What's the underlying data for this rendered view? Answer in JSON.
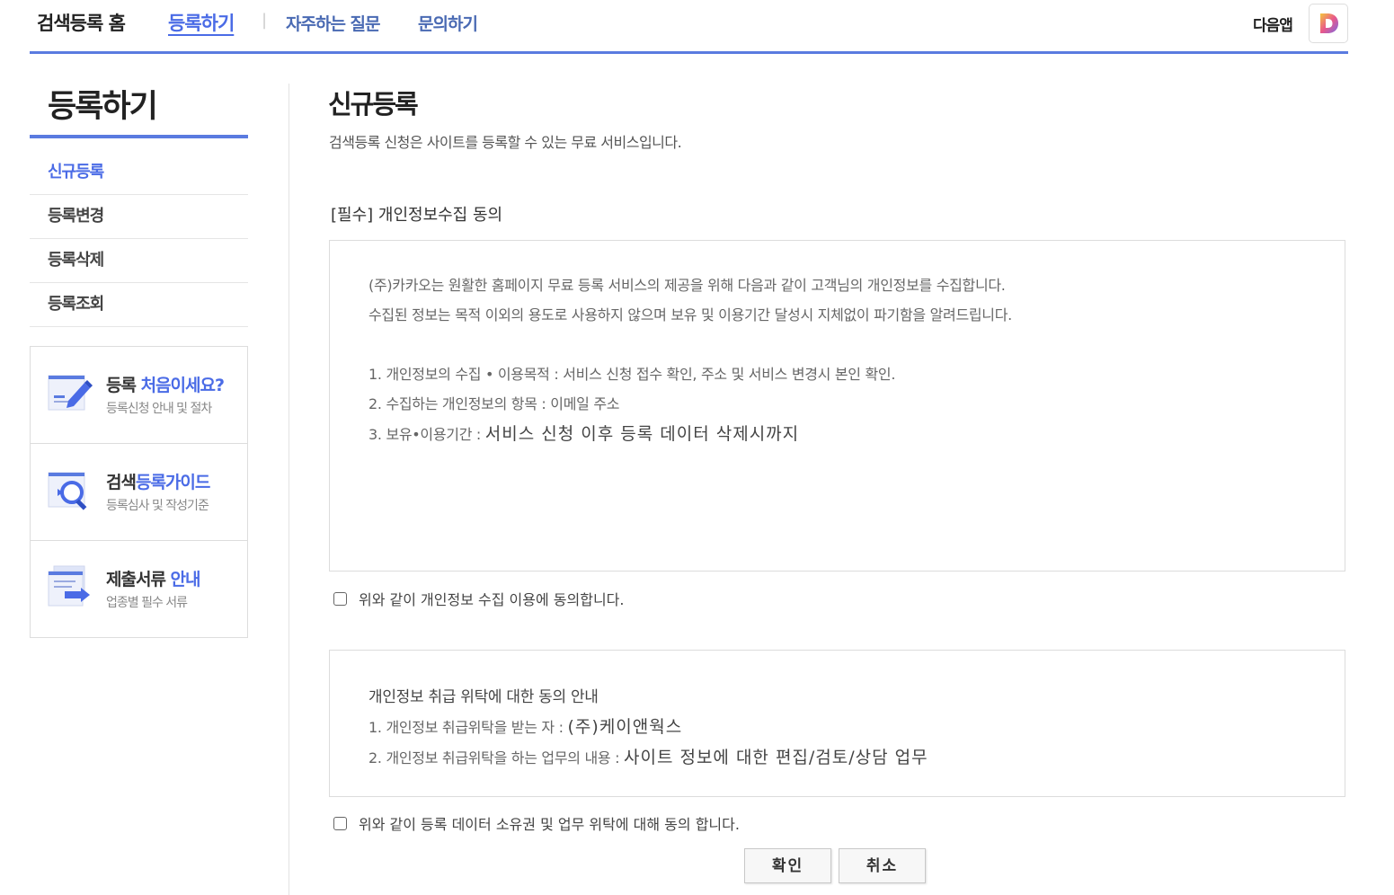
{
  "topnav": {
    "home": "검색등록 홈",
    "register": "등록하기",
    "separator": "|",
    "faq": "자주하는 질문",
    "contact": "문의하기",
    "app_label": "다음앱"
  },
  "sidebar": {
    "title": "등록하기",
    "items": [
      {
        "label": "신규등록",
        "active": true
      },
      {
        "label": "등록변경"
      },
      {
        "label": "등록삭제"
      },
      {
        "label": "등록조회"
      }
    ],
    "cards": [
      {
        "title_plain": "등록 ",
        "title_highlight": "처음이세요?",
        "subtitle": "등록신청 안내 및 절차",
        "icon": "pencil-document-icon"
      },
      {
        "title_plain": "검색",
        "title_highlight": "등록가이드",
        "subtitle": "등록심사 및 작성기준",
        "icon": "magnifier-document-icon"
      },
      {
        "title_plain": "제출서류 ",
        "title_highlight": "안내",
        "subtitle": "업종별 필수 서류",
        "icon": "documents-arrow-icon"
      }
    ]
  },
  "main": {
    "title": "신규등록",
    "description": "검색등록 신청은 사이트를 등록할 수 있는 무료 서비스입니다.",
    "privacy_section_title": "[필수] 개인정보수집 동의",
    "privacy_box": {
      "intro1": "(주)카카오는 원활한 홈페이지 무료 등록 서비스의 제공을 위해 다음과 같이 고객님의 개인정보를 수집합니다.",
      "intro2": "수집된 정보는 목적 이외의 용도로 사용하지 않으며 보유 및 이용기간 달성시 지체없이 파기함을 알려드립니다.",
      "item1": "1. 개인정보의 수집 • 이용목적 : 서비스 신청 접수 확인,  주소 및 서비스 변경시 본인 확인.",
      "item2": "2. 수집하는 개인정보의 항목 : 이메일 주소",
      "item3_label": "3. 보유•이용기간 : ",
      "item3_value": "서비스 신청 이후 등록 데이터 삭제시까지"
    },
    "privacy_checkbox_label": "위와 같이 개인정보 수집 이용에 동의합니다.",
    "consign_box": {
      "heading": "개인정보 취급 위탁에 대한 동의 안내",
      "item1_label": "1. 개인정보 취급위탁을 받는 자 : ",
      "item1_value": "(주)케이앤웍스",
      "item2_label": "2. 개인정보 취급위탁을 하는 업무의 내용 : ",
      "item2_value": "사이트 정보에 대한 편집/검토/상담 업무"
    },
    "consign_checkbox_label": "위와 같이 등록 데이터 소유권 및 업무 위탁에 대해 동의 합니다.",
    "buttons": {
      "ok": "확인",
      "cancel": "취소"
    }
  },
  "colors": {
    "accent": "#5a7be0",
    "link": "#4a6be6"
  }
}
